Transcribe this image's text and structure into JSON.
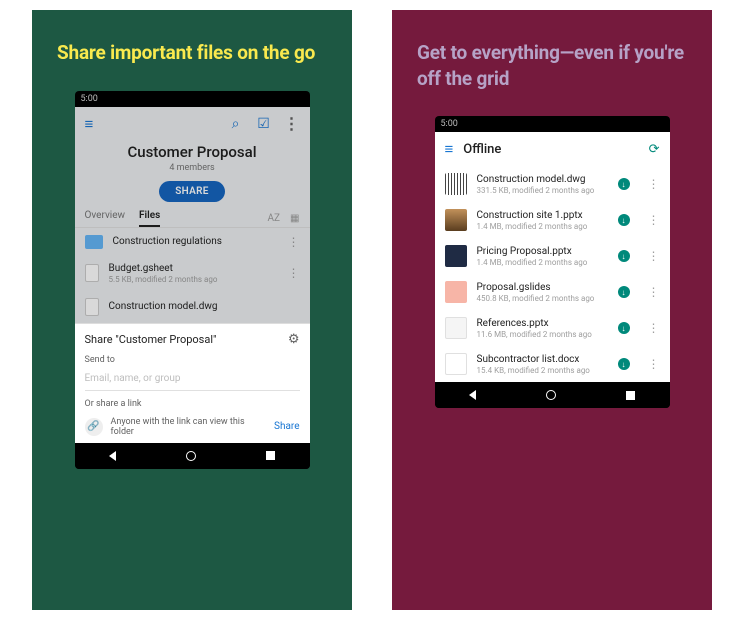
{
  "left": {
    "headline": "Share important files on the go",
    "statusbar_time": "5:00",
    "folder_title": "Customer Proposal",
    "members": "4 members",
    "share_button": "SHARE",
    "tabs": {
      "overview": "Overview",
      "files": "Files",
      "sort": "AZ"
    },
    "files": [
      {
        "name": "Construction regulations",
        "meta": ""
      },
      {
        "name": "Budget.gsheet",
        "meta": "5.5 KB, modified 2 months ago"
      },
      {
        "name": "Construction model.dwg",
        "meta": ""
      }
    ],
    "sheet": {
      "title": "Share \"Customer Proposal\"",
      "send_to": "Send to",
      "placeholder": "Email, name, or group",
      "or_share": "Or share a link",
      "link_desc": "Anyone with the link can view this folder",
      "link_action": "Share"
    }
  },
  "right": {
    "headline": "Get to everything—even if you're off the grid",
    "statusbar_time": "5:00",
    "title": "Offline",
    "files": [
      {
        "name": "Construction model.dwg",
        "meta": "331.5 KB, modified 2 months ago",
        "thumb": "dwg"
      },
      {
        "name": "Construction site 1.pptx",
        "meta": "1.4 MB, modified 2 months ago",
        "thumb": "pp1"
      },
      {
        "name": "Pricing Proposal.pptx",
        "meta": "1.4 MB, modified 2 months ago",
        "thumb": "pp2"
      },
      {
        "name": "Proposal.gslides",
        "meta": "450.8 KB, modified 2 months ago",
        "thumb": "sl"
      },
      {
        "name": "References.pptx",
        "meta": "11.6 MB, modified 2 months ago",
        "thumb": "ref"
      },
      {
        "name": "Subcontractor list.docx",
        "meta": "15.4 KB, modified 2 months ago",
        "thumb": "doc"
      }
    ]
  }
}
